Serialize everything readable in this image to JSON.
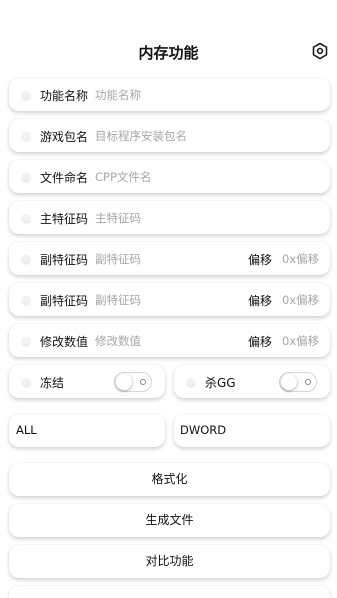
{
  "header": {
    "title": "内存功能",
    "settings_icon": "hexagon-settings-icon"
  },
  "fields": [
    {
      "label": "功能名称",
      "placeholder": "功能名称"
    },
    {
      "label": "游戏包名",
      "placeholder": "目标程序安装包名"
    },
    {
      "label": "文件命名",
      "placeholder": "CPP文件名"
    },
    {
      "label": "主特征码",
      "placeholder": "主特征码"
    },
    {
      "label": "副特征码",
      "placeholder": "副特征码",
      "offset_label": "偏移",
      "offset_placeholder": "0x偏移"
    },
    {
      "label": "副特征码",
      "placeholder": "副特征码",
      "offset_label": "偏移",
      "offset_placeholder": "0x偏移"
    },
    {
      "label": "修改数值",
      "placeholder": "修改数值",
      "offset_label": "偏移",
      "offset_placeholder": "0x偏移"
    }
  ],
  "toggles": [
    {
      "label": "冻结",
      "on": false
    },
    {
      "label": "杀GG",
      "on": false
    }
  ],
  "selects": {
    "range": "ALL",
    "type": "DWORD"
  },
  "buttons": {
    "format": "格式化",
    "generate": "生成文件",
    "compare": "对比功能"
  }
}
